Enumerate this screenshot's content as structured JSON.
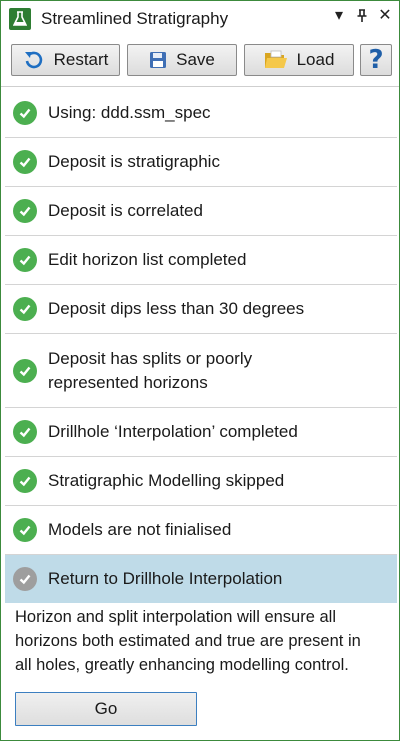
{
  "window": {
    "title": "Streamlined Stratigraphy",
    "controls": {
      "dropdown": "▾",
      "pin": "⊥",
      "close": "✕"
    }
  },
  "toolbar": {
    "restart_label": "Restart",
    "save_label": "Save",
    "load_label": "Load",
    "help_label": "?"
  },
  "steps": [
    {
      "label": "Using: ddd.ssm_spec",
      "status": "done"
    },
    {
      "label": "Deposit is stratigraphic",
      "status": "done"
    },
    {
      "label": "Deposit is correlated",
      "status": "done"
    },
    {
      "label": "Edit horizon list completed",
      "status": "done"
    },
    {
      "label": "Deposit dips less than 30 degrees",
      "status": "done"
    },
    {
      "label_line1": "Deposit has splits or poorly",
      "label_line2": "represented horizons",
      "status": "done"
    },
    {
      "label": "Drillhole ‘Interpolation’ completed",
      "status": "done"
    },
    {
      "label": "Stratigraphic Modelling skipped",
      "status": "done"
    },
    {
      "label": "Models are not finialised",
      "status": "done"
    },
    {
      "label": "Return to Drillhole Interpolation",
      "status": "current"
    }
  ],
  "description": {
    "line1": "Horizon and split interpolation will ensure all",
    "line2": "horizons both estimated and true are present in",
    "line3": "all holes, greatly enhancing modelling control."
  },
  "go_label": "Go",
  "colors": {
    "accent_green": "#4caf50",
    "current_step_bg": "#bfdbe8",
    "help_blue": "#1f5fa8"
  },
  "icons": {
    "app": "flask-icon",
    "restart": "restart-arrow-icon",
    "save": "floppy-disk-icon",
    "load": "folder-icon",
    "step_done": "check-circle-icon"
  }
}
